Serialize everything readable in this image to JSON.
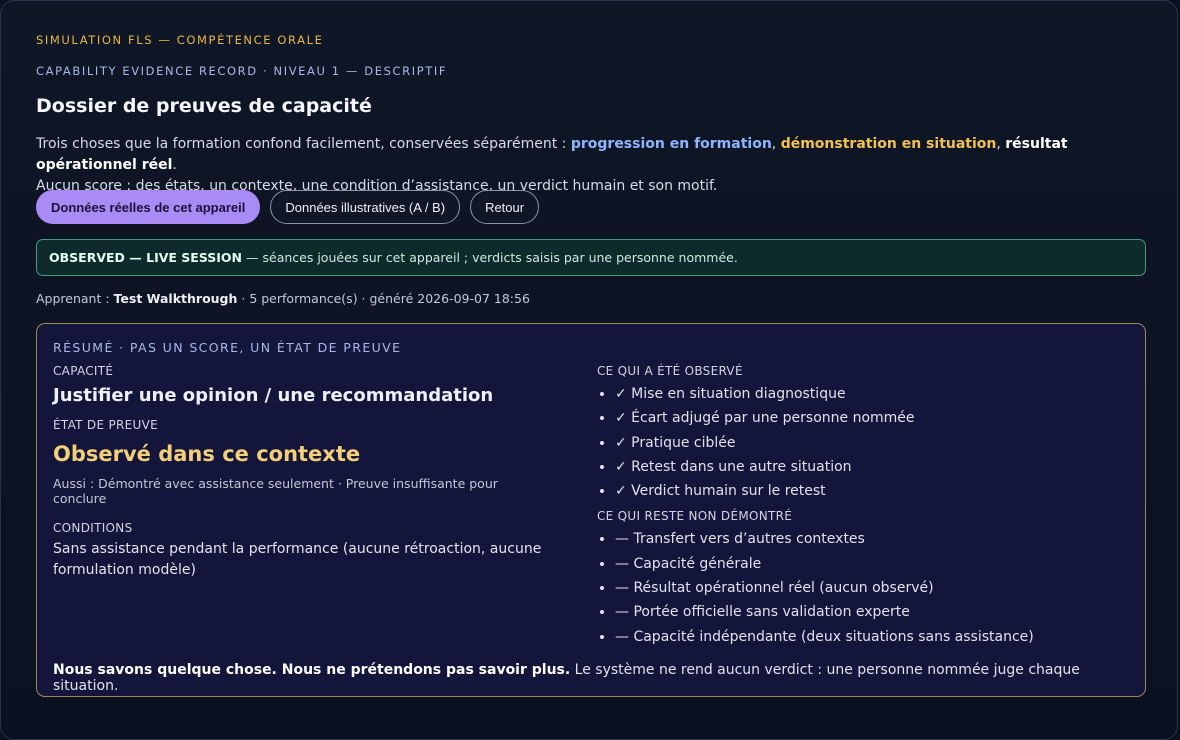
{
  "header": {
    "eyebrow": "SIMULATION FLS — COMPÉTENCE ORALE",
    "subeyebrow": "CAPABILITY EVIDENCE RECORD · NIVEAU 1 — DESCRIPTIF",
    "title": "Dossier de preuves de capacité"
  },
  "intro": {
    "line1_prefix": "Trois choses que la formation confond facilement, conservées séparément : ",
    "term1": "progression en formation",
    "sep1": ", ",
    "term2": "démonstration en situation",
    "sep2": ", ",
    "term3": "résultat opérationnel réel",
    "line1_suffix": ".",
    "line2": "Aucun score : des états, un contexte, une condition d’assistance, un verdict humain et son motif."
  },
  "buttons": {
    "real": "Données réelles de cet appareil",
    "illustrative": "Données illustratives (A / B)",
    "back": "Retour"
  },
  "observed": {
    "tag": "OBSERVED — LIVE SESSION",
    "text": "— séances jouées sur cet appareil ; verdicts saisis par une personne nommée."
  },
  "learner": {
    "prefix": "Apprenant : ",
    "name": "Test Walkthrough",
    "meta": " · 5 performance(s) · généré 2026-09-07 18:56"
  },
  "summary": {
    "title": "RÉSUMÉ · PAS UN SCORE, UN ÉTAT DE PREUVE",
    "capacity_label": "CAPACITÉ",
    "capacity": "Justifier une opinion / une recommandation",
    "state_label": "ÉTAT DE PREUVE",
    "state": "Observé dans ce contexte",
    "aussi": "Aussi : Démontré avec assistance seulement · Preuve insuffisante pour conclure",
    "conditions_label": "CONDITIONS",
    "conditions": "Sans assistance pendant la performance (aucune rétroaction, aucune formulation modèle)",
    "observed_label": "CE QUI A ÉTÉ OBSERVÉ",
    "observed_items": [
      "✓ Mise en situation diagnostique",
      "✓ Écart adjugé par une personne nommée",
      "✓ Pratique ciblée",
      "✓ Retest dans une autre situation",
      "✓ Verdict humain sur le retest"
    ],
    "not_demo_label": "CE QUI RESTE NON DÉMONTRÉ",
    "not_demo_items": [
      "— Transfert vers d’autres contextes",
      "— Capacité générale",
      "— Résultat opérationnel réel (aucun observé)",
      "— Portée officielle sans validation experte",
      "— Capacité indépendante (deux situations sans assistance)"
    ],
    "footer_bold": "Nous savons quelque chose. Nous ne prétendons pas savoir plus.",
    "footer_rest": " Le système ne rend aucun verdict : une personne nommée juge chaque situation."
  }
}
